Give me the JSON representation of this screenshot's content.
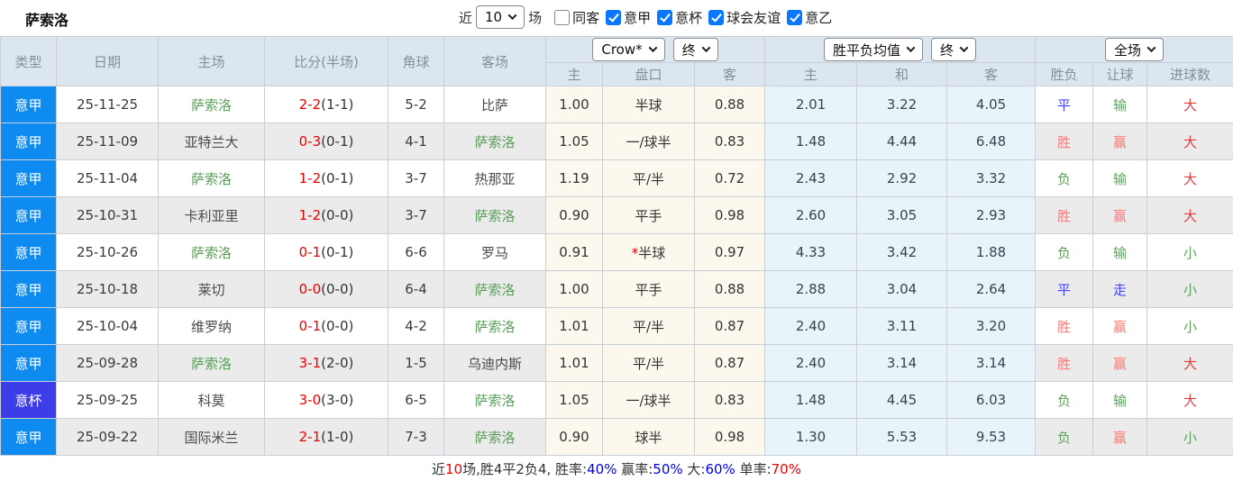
{
  "topbar": {
    "title": "萨索洛",
    "recent_label": "近",
    "recent_select": "10",
    "matches_label": "场",
    "filters": [
      {
        "id": "same-away",
        "label": "同客",
        "checked": false
      },
      {
        "id": "serie-a",
        "label": "意甲",
        "checked": true
      },
      {
        "id": "coppa-italia",
        "label": "意杯",
        "checked": true
      },
      {
        "id": "club-friendly",
        "label": "球会友谊",
        "checked": true
      },
      {
        "id": "serie-b",
        "label": "意乙",
        "checked": true
      }
    ]
  },
  "table": {
    "header": {
      "type": "类型",
      "date": "日期",
      "home": "主场",
      "score": "比分(半场)",
      "corner": "角球",
      "away": "客场",
      "odds_group": {
        "select1": "Crow*",
        "select2": "终",
        "col_home": "主",
        "col_line": "盘口",
        "col_away": "客"
      },
      "avg_group": {
        "select1": "胜平负均值",
        "select2": "终",
        "col_home": "主",
        "col_draw": "和",
        "col_away": "客"
      },
      "result_group": {
        "select1": "全场",
        "col_wdl": "胜负",
        "col_handicap": "让球",
        "col_goals": "进球数"
      }
    },
    "rows": [
      {
        "type": "意甲",
        "cup": false,
        "date": "25-11-25",
        "home": "萨索洛",
        "hf": true,
        "ft": "2-2",
        "ht": "(1-1)",
        "corner": "5-2",
        "away": "比萨",
        "af": false,
        "oh": "1.00",
        "line": "半球",
        "star": false,
        "oa": "0.88",
        "ah": "2.01",
        "ad": "3.22",
        "aa": "4.05",
        "wdl": {
          "t": "平",
          "c": "blue"
        },
        "hresult": {
          "t": "输",
          "c": "green"
        },
        "goal": {
          "t": "大",
          "c": "red"
        }
      },
      {
        "type": "意甲",
        "cup": false,
        "date": "25-11-09",
        "home": "亚特兰大",
        "hf": false,
        "ft": "0-3",
        "ht": "(0-1)",
        "corner": "4-1",
        "away": "萨索洛",
        "af": true,
        "oh": "1.05",
        "line": "一/球半",
        "star": false,
        "oa": "0.83",
        "ah": "1.48",
        "ad": "4.44",
        "aa": "6.48",
        "wdl": {
          "t": "胜",
          "c": "lightred"
        },
        "hresult": {
          "t": "赢",
          "c": "lightred"
        },
        "goal": {
          "t": "大",
          "c": "red"
        }
      },
      {
        "type": "意甲",
        "cup": false,
        "date": "25-11-04",
        "home": "萨索洛",
        "hf": true,
        "ft": "1-2",
        "ht": "(0-1)",
        "corner": "3-7",
        "away": "热那亚",
        "af": false,
        "oh": "1.19",
        "line": "平/半",
        "star": false,
        "oa": "0.72",
        "ah": "2.43",
        "ad": "2.92",
        "aa": "3.32",
        "wdl": {
          "t": "负",
          "c": "green"
        },
        "hresult": {
          "t": "输",
          "c": "green"
        },
        "goal": {
          "t": "大",
          "c": "red"
        }
      },
      {
        "type": "意甲",
        "cup": false,
        "date": "25-10-31",
        "home": "卡利亚里",
        "hf": false,
        "ft": "1-2",
        "ht": "(0-0)",
        "corner": "3-7",
        "away": "萨索洛",
        "af": true,
        "oh": "0.90",
        "line": "平手",
        "star": false,
        "oa": "0.98",
        "ah": "2.60",
        "ad": "3.05",
        "aa": "2.93",
        "wdl": {
          "t": "胜",
          "c": "lightred"
        },
        "hresult": {
          "t": "赢",
          "c": "lightred"
        },
        "goal": {
          "t": "大",
          "c": "red"
        }
      },
      {
        "type": "意甲",
        "cup": false,
        "date": "25-10-26",
        "home": "萨索洛",
        "hf": true,
        "ft": "0-1",
        "ht": "(0-1)",
        "corner": "6-6",
        "away": "罗马",
        "af": false,
        "oh": "0.91",
        "line": "半球",
        "star": true,
        "oa": "0.97",
        "ah": "4.33",
        "ad": "3.42",
        "aa": "1.88",
        "wdl": {
          "t": "负",
          "c": "green"
        },
        "hresult": {
          "t": "输",
          "c": "green"
        },
        "goal": {
          "t": "小",
          "c": "green"
        }
      },
      {
        "type": "意甲",
        "cup": false,
        "date": "25-10-18",
        "home": "莱切",
        "hf": false,
        "ft": "0-0",
        "ht": "(0-0)",
        "corner": "6-4",
        "away": "萨索洛",
        "af": true,
        "oh": "1.00",
        "line": "平手",
        "star": false,
        "oa": "0.88",
        "ah": "2.88",
        "ad": "3.04",
        "aa": "2.64",
        "wdl": {
          "t": "平",
          "c": "blue"
        },
        "hresult": {
          "t": "走",
          "c": "blue"
        },
        "goal": {
          "t": "小",
          "c": "green"
        }
      },
      {
        "type": "意甲",
        "cup": false,
        "date": "25-10-04",
        "home": "维罗纳",
        "hf": false,
        "ft": "0-1",
        "ht": "(0-0)",
        "corner": "4-2",
        "away": "萨索洛",
        "af": true,
        "oh": "1.01",
        "line": "平/半",
        "star": false,
        "oa": "0.87",
        "ah": "2.40",
        "ad": "3.11",
        "aa": "3.20",
        "wdl": {
          "t": "胜",
          "c": "lightred"
        },
        "hresult": {
          "t": "赢",
          "c": "lightred"
        },
        "goal": {
          "t": "小",
          "c": "green"
        }
      },
      {
        "type": "意甲",
        "cup": false,
        "date": "25-09-28",
        "home": "萨索洛",
        "hf": true,
        "ft": "3-1",
        "ht": "(2-0)",
        "corner": "1-5",
        "away": "乌迪内斯",
        "af": false,
        "oh": "1.01",
        "line": "平/半",
        "star": false,
        "oa": "0.87",
        "ah": "2.40",
        "ad": "3.14",
        "aa": "3.14",
        "wdl": {
          "t": "胜",
          "c": "lightred"
        },
        "hresult": {
          "t": "赢",
          "c": "lightred"
        },
        "goal": {
          "t": "大",
          "c": "red"
        }
      },
      {
        "type": "意杯",
        "cup": true,
        "date": "25-09-25",
        "home": "科莫",
        "hf": false,
        "ft": "3-0",
        "ht": "(3-0)",
        "corner": "6-5",
        "away": "萨索洛",
        "af": true,
        "oh": "1.05",
        "line": "一/球半",
        "star": false,
        "oa": "0.83",
        "ah": "1.48",
        "ad": "4.45",
        "aa": "6.03",
        "wdl": {
          "t": "负",
          "c": "green"
        },
        "hresult": {
          "t": "输",
          "c": "green"
        },
        "goal": {
          "t": "大",
          "c": "red"
        }
      },
      {
        "type": "意甲",
        "cup": false,
        "date": "25-09-22",
        "home": "国际米兰",
        "hf": false,
        "ft": "2-1",
        "ht": "(1-0)",
        "corner": "7-3",
        "away": "萨索洛",
        "af": true,
        "oh": "0.90",
        "line": "球半",
        "star": false,
        "oa": "0.98",
        "ah": "1.30",
        "ad": "5.53",
        "aa": "9.53",
        "wdl": {
          "t": "负",
          "c": "green"
        },
        "hresult": {
          "t": "赢",
          "c": "lightred"
        },
        "goal": {
          "t": "小",
          "c": "green"
        }
      }
    ]
  },
  "summary": {
    "segments": [
      {
        "text": "近",
        "color": "#333333"
      },
      {
        "text": "10",
        "color": "#ee0000"
      },
      {
        "text": "场,胜4平2负4, 胜率:",
        "color": "#333333"
      },
      {
        "text": "40%",
        "color": "#0000ee"
      },
      {
        "text": " 赢率:",
        "color": "#333333"
      },
      {
        "text": "50%",
        "color": "#0000ee"
      },
      {
        "text": " 大:",
        "color": "#333333"
      },
      {
        "text": "60%",
        "color": "#0000ee"
      },
      {
        "text": " 单率:",
        "color": "#333333"
      },
      {
        "text": "70%",
        "color": "#ee0000"
      }
    ]
  },
  "colors": {
    "league_type_bg": "#0d8bf0",
    "cup_type_bg": "#3c3ce8",
    "header_bg": "#dce6f1",
    "focus_team_green": "#5a9e5a",
    "score_red": "#e80000",
    "odds_bg": "#fdf8ee",
    "avg_bg": "#e8f3fa",
    "stripe_gray": "#ebebeb",
    "result_red": "#e23d3d",
    "result_lightred": "#ff7676",
    "result_green": "#5fa05f",
    "result_blue": "#4444f4",
    "checkbox_blue": "#0b76ff"
  }
}
